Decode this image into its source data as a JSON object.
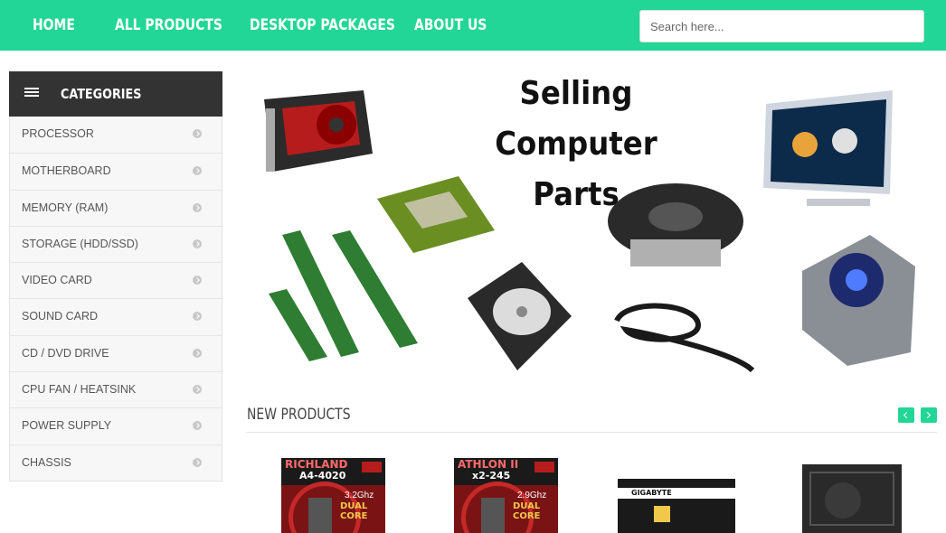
{
  "nav": {
    "items": [
      {
        "label": "HOME"
      },
      {
        "label": "ALL PRODUCTS"
      },
      {
        "label": "DESKTOP PACKAGES"
      },
      {
        "label": "ABOUT US"
      }
    ],
    "search_placeholder": "Search here..."
  },
  "sidebar": {
    "title": "CATEGORIES",
    "items": [
      {
        "label": "PROCESSOR"
      },
      {
        "label": "MOTHERBOARD"
      },
      {
        "label": "MEMORY (RAM)"
      },
      {
        "label": "STORAGE (HDD/SSD)"
      },
      {
        "label": "VIDEO CARD"
      },
      {
        "label": "SOUND CARD"
      },
      {
        "label": "CD / DVD DRIVE"
      },
      {
        "label": "CPU FAN / HEATSINK"
      },
      {
        "label": "POWER SUPPLY"
      },
      {
        "label": "CHASSIS"
      }
    ]
  },
  "banner": {
    "title_line1": "Selling Computer",
    "title_line2": "Parts"
  },
  "new_products": {
    "title": "NEW PRODUCTS",
    "products": [
      {
        "brand": "RICHLAND",
        "model": "A4-4020",
        "speed": "3.2Ghz",
        "core": "DUAL CORE"
      },
      {
        "brand": "ATHLON II",
        "model": "x2-245",
        "speed": "2.9Ghz",
        "core": "DUAL CORE"
      },
      {
        "brand": "GIGABYTE"
      }
    ]
  },
  "colors": {
    "accent": "#22d698",
    "sidebar_header": "#333333"
  }
}
